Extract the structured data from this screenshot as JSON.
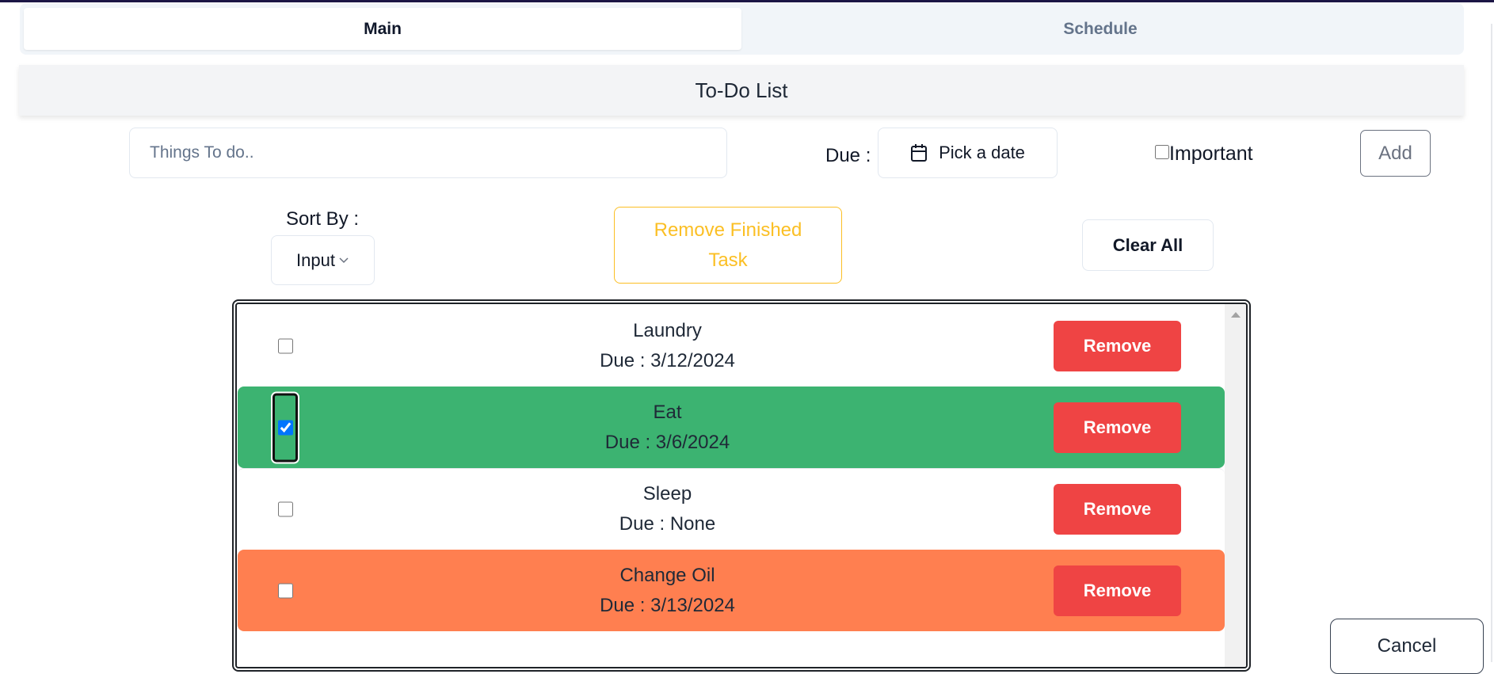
{
  "tabs": [
    {
      "label": "Main",
      "active": true
    },
    {
      "label": "Schedule",
      "active": false
    }
  ],
  "header": {
    "title": "To-Do List"
  },
  "form": {
    "task_input": {
      "value": "",
      "placeholder": "Things To do.."
    },
    "due_label": "Due :",
    "date_picker": {
      "icon": "calendar-icon",
      "label": "Pick a date"
    },
    "important": {
      "label": "Important",
      "checked": false
    },
    "add_label": "Add"
  },
  "controls": {
    "sort_label": "Sort By :",
    "sort_value": "Input",
    "remove_finished_label": "Remove Finished Task",
    "clear_all_label": "Clear All"
  },
  "tasks": [
    {
      "name": "Laundry",
      "due": "Due : 3/12/2024",
      "done": false,
      "highlight": "none",
      "remove_label": "Remove"
    },
    {
      "name": "Eat",
      "due": "Due : 3/6/2024",
      "done": true,
      "highlight": "green",
      "remove_label": "Remove"
    },
    {
      "name": "Sleep",
      "due": "Due : None",
      "done": false,
      "highlight": "none",
      "remove_label": "Remove"
    },
    {
      "name": "Change Oil",
      "due": "Due : 3/13/2024",
      "done": false,
      "highlight": "orange",
      "remove_label": "Remove"
    }
  ],
  "footer": {
    "cancel_label": "Cancel"
  },
  "colors": {
    "done_row": "#3cb371",
    "important_row": "#ff7f50",
    "remove_button": "#ef4444",
    "remove_finished_accent": "#fbbf24",
    "top_strip": "#1c1645"
  }
}
